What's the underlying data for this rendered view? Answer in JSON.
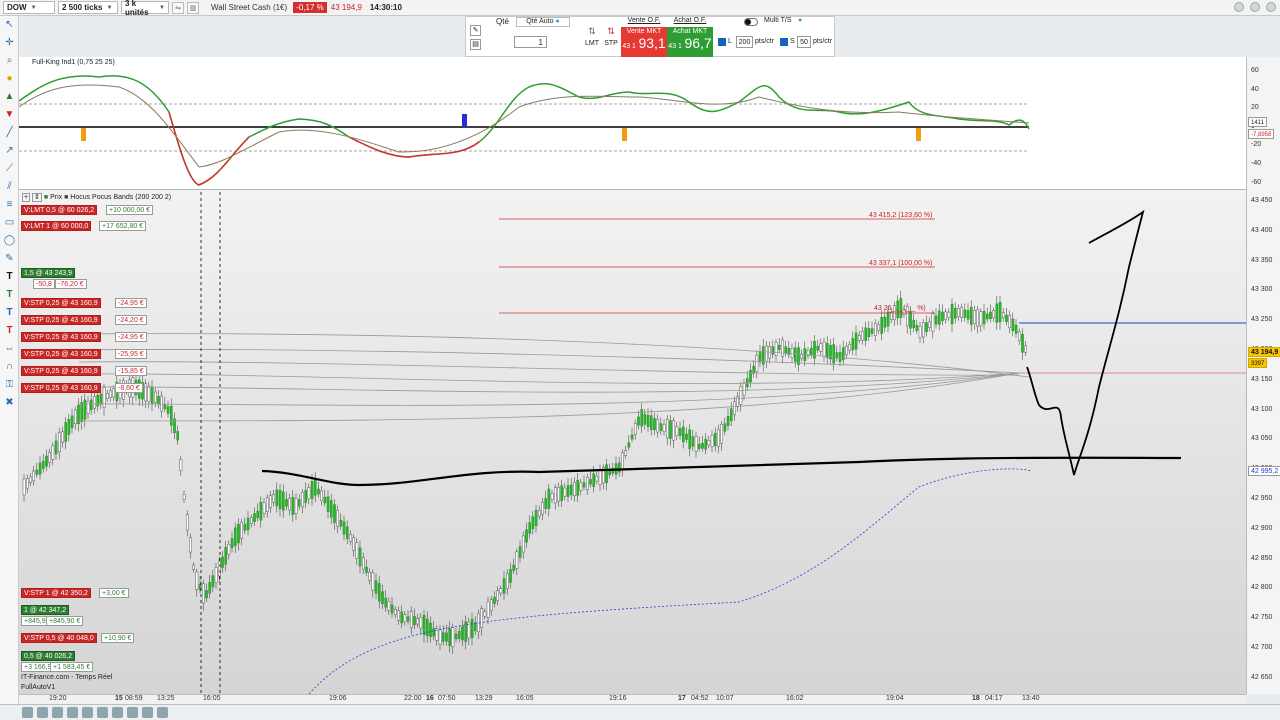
{
  "topbar": {
    "instrument": "DOW",
    "ticks": "2 500 ticks",
    "units": "3 k unités",
    "title": "Wall Street Cash (1€)",
    "change": "-0,17 %",
    "price": "43 194,9",
    "time": "14:30:10"
  },
  "order_panel": {
    "qty_label": "Qté",
    "qty_auto_label": "Qté Auto",
    "qty_value": "1",
    "lmt_label": "LMT",
    "stp_label": "STP",
    "sell_header": "Vente O.F.",
    "buy_header": "Achat O.F.",
    "sell_btn": "Vente MKT",
    "buy_btn": "Achat MKT",
    "sell_prefix": "43 1",
    "sell_price": "93,1",
    "buy_prefix": "43 1",
    "buy_price": "96,7",
    "multi_label": "Multi T/S",
    "l_label": "L",
    "l_value": "200",
    "l_unit": "pts/ctr",
    "s_label": "S",
    "s_value": "50",
    "s_unit": "pts/ctr"
  },
  "oscillator": {
    "title": "Full-King Ind1 (0,75 25 25)",
    "y_labels": [
      "60",
      "40",
      "20",
      "0",
      "-20",
      "-40",
      "-60"
    ],
    "tags": [
      "1411",
      "-7,8958"
    ]
  },
  "chart": {
    "price_label": "Prix",
    "indicator_label": "Hocus Pocus Bands (200 200 2)",
    "y_labels": [
      "43 450",
      "43 400",
      "43 350",
      "43 300",
      "43 250",
      "43 200",
      "43 150",
      "43 100",
      "43 050",
      "43 000",
      "42 950",
      "42 900",
      "42 850",
      "42 800",
      "42 750",
      "42 700",
      "42 650"
    ],
    "current_price": "43 194,9",
    "current_sub": "3397",
    "support_price": "42 995,2",
    "fib_levels": [
      "43 415,2 (123,60 %)",
      "43 337,1 (100,00 %)",
      "43 26_,_ (_,_ %)"
    ],
    "orders_top": [
      {
        "label": "V:LMT 0,5 @ 60 026,2",
        "pnl": "+10 000,00 €"
      },
      {
        "label": "V:LMT 1 @ 60 000,0",
        "pnl": "+17 652,80 €"
      }
    ],
    "position_top": {
      "label": "1,5 @ 43 243,9",
      "pnl1": "-50,8",
      "pnl2": "-76,20 €"
    },
    "stops_top": [
      {
        "label": "V:STP 0,25 @ 43 160,9",
        "pnl": "-24,95 €"
      },
      {
        "label": "V:STP 0,25 @ 43 160,9",
        "pnl": "-24,20 €"
      },
      {
        "label": "V:STP 0,25 @ 43 160,9",
        "pnl": "-24,95 €"
      },
      {
        "label": "V:STP 0,25 @ 43 160,9",
        "pnl": "-25,95 €"
      },
      {
        "label": "V:STP 0,25 @ 43 160,9",
        "pnl": "-15,85 €"
      },
      {
        "label": "V:STP 0,25 @ 43 160,9",
        "pnl": "-8,60 €"
      }
    ],
    "orders_bottom": [
      {
        "label": "V:STP 1 @ 42 350,2",
        "pnl": "+3,00 €"
      },
      {
        "label": "1 @ 42 347,2",
        "pnl1": "+845,9",
        "pnl2": "+845,90 €"
      },
      {
        "label": "V:STP 0,5 @ 40 048,0",
        "pnl": "+10,90 €"
      },
      {
        "label": "0,5 @ 40 026,2",
        "pnl1": "+3 166,9",
        "pnl2": "+1 583,45 €"
      }
    ],
    "footer_source": "IT-Finance.com - Temps Réel",
    "footer_strategy": "FullAutoV1"
  },
  "xaxis": [
    {
      "t": "19:20",
      "bold": false
    },
    {
      "t": "15",
      "bold": true
    },
    {
      "t": "08:59",
      "bold": false
    },
    {
      "t": "13:25",
      "bold": false
    },
    {
      "t": "16:05",
      "bold": false
    },
    {
      "t": "19:06",
      "bold": false
    },
    {
      "t": "22:00",
      "bold": false
    },
    {
      "t": "16",
      "bold": true
    },
    {
      "t": "07:50",
      "bold": false
    },
    {
      "t": "13:29",
      "bold": false
    },
    {
      "t": "16:05",
      "bold": false
    },
    {
      "t": "19:16",
      "bold": false
    },
    {
      "t": "17",
      "bold": true
    },
    {
      "t": "04:52",
      "bold": false
    },
    {
      "t": "10:07",
      "bold": false
    },
    {
      "t": "16:02",
      "bold": false
    },
    {
      "t": "19:04",
      "bold": false
    },
    {
      "t": "18",
      "bold": true
    },
    {
      "t": "04:17",
      "bold": false
    },
    {
      "t": "13:40",
      "bold": false
    }
  ],
  "colors": {
    "up": "#2db52d",
    "down": "#d32f2f",
    "accent": "#1565c0"
  }
}
